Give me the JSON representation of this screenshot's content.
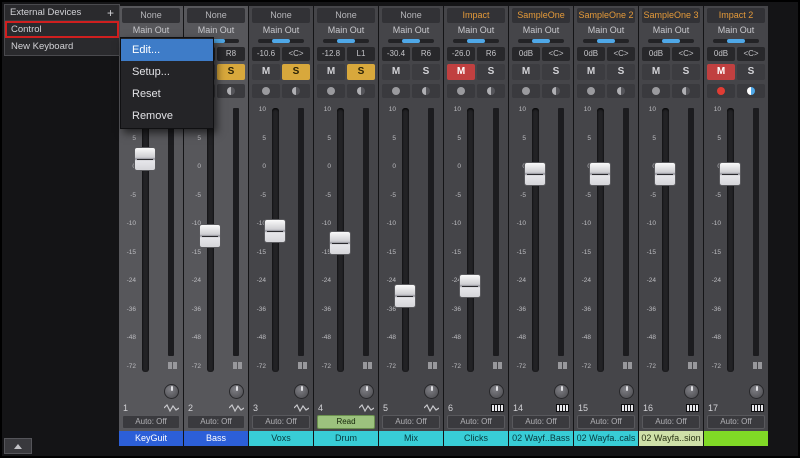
{
  "external_devices": {
    "title": "External Devices",
    "add_label": "+",
    "items": [
      {
        "label": "Control",
        "selected": true
      },
      {
        "label": "New Keyboard",
        "selected": false
      }
    ]
  },
  "context_menu": {
    "items": [
      {
        "label": "Edit...",
        "highlighted": true
      },
      {
        "label": "Setup...",
        "highlighted": false
      },
      {
        "label": "Reset",
        "highlighted": false
      },
      {
        "label": "Remove",
        "highlighted": false
      }
    ]
  },
  "colors": {
    "pan_accent": "#4fa8e8",
    "mute_active": "#c04040",
    "solo_active": "#d8a83c",
    "record_active": "#e03c34",
    "monitor_active": "#4fa8e8",
    "menu_highlight": "#3e7cc8",
    "selection_outline": "#cf1f1f"
  },
  "mixer": {
    "output_label": "Main Out",
    "mute_label": "M",
    "solo_label": "S",
    "scale_labels": [
      "10",
      "5",
      "0",
      "-5",
      "-10",
      "-15",
      "-24",
      "-36",
      "-48",
      "-72"
    ],
    "strips": [
      {
        "number": "1",
        "insert": "None",
        "instrument": false,
        "volume": "",
        "pan": "",
        "mute": false,
        "solo": false,
        "record": false,
        "monitor": false,
        "fader_pos": 0.16,
        "automation": "Auto: Off",
        "automation_read": false,
        "name": "KeyGuit",
        "name_color": "#2c5fd8",
        "name_text_color": "#ffffff",
        "icon": "wave",
        "selected": true
      },
      {
        "number": "2",
        "insert": "None",
        "instrument": false,
        "volume": "",
        "pan": "R8",
        "mute": false,
        "solo": true,
        "record": false,
        "monitor": false,
        "fader_pos": 0.48,
        "automation": "Auto: Off",
        "automation_read": false,
        "name": "Bass",
        "name_color": "#2c5fd8",
        "name_text_color": "#ffffff",
        "icon": "wave",
        "selected": true
      },
      {
        "number": "3",
        "insert": "None",
        "instrument": false,
        "volume": "-10.6",
        "pan": "<C>",
        "mute": false,
        "solo": true,
        "record": false,
        "monitor": false,
        "fader_pos": 0.458,
        "automation": "Auto: Off",
        "automation_read": false,
        "name": "Voxs",
        "name_color": "#38cdd6",
        "name_text_color": "#063a3e",
        "icon": "wave",
        "selected": false
      },
      {
        "number": "4",
        "insert": "None",
        "instrument": false,
        "volume": "-12.8",
        "pan": "L1",
        "mute": false,
        "solo": true,
        "record": false,
        "monitor": false,
        "fader_pos": 0.507,
        "automation": "Read",
        "automation_read": true,
        "name": "Drum",
        "name_color": "#38cdd6",
        "name_text_color": "#063a3e",
        "icon": "wave",
        "selected": false
      },
      {
        "number": "5",
        "insert": "None",
        "instrument": false,
        "volume": "-30.4",
        "pan": "R6",
        "mute": false,
        "solo": false,
        "record": false,
        "monitor": false,
        "fader_pos": 0.726,
        "automation": "Auto: Off",
        "automation_read": false,
        "name": "Mix",
        "name_color": "#38cdd6",
        "name_text_color": "#063a3e",
        "icon": "wave",
        "selected": false
      },
      {
        "number": "6",
        "insert": "Impact",
        "instrument": true,
        "volume": "-26.0",
        "pan": "R6",
        "mute": true,
        "solo": false,
        "record": false,
        "monitor": false,
        "fader_pos": 0.685,
        "automation": "Auto: Off",
        "automation_read": false,
        "name": "Clicks",
        "name_color": "#38cdd6",
        "name_text_color": "#063a3e",
        "icon": "keys",
        "selected": false
      },
      {
        "number": "14",
        "insert": "SampleOne",
        "instrument": true,
        "volume": "0dB",
        "pan": "<C>",
        "mute": false,
        "solo": false,
        "record": false,
        "monitor": false,
        "fader_pos": 0.222,
        "automation": "Auto: Off",
        "automation_read": false,
        "name": "02 Wayf..Bass",
        "name_color": "#38cdd6",
        "name_text_color": "#063a3e",
        "icon": "keys",
        "selected": false
      },
      {
        "number": "15",
        "insert": "SampleOne 2",
        "instrument": true,
        "volume": "0dB",
        "pan": "<C>",
        "mute": false,
        "solo": false,
        "record": false,
        "monitor": false,
        "fader_pos": 0.222,
        "automation": "Auto: Off",
        "automation_read": false,
        "name": "02 Wayfa..cals",
        "name_color": "#38cdd6",
        "name_text_color": "#063a3e",
        "icon": "keys",
        "selected": false
      },
      {
        "number": "16",
        "insert": "SampleOne 3",
        "instrument": true,
        "volume": "0dB",
        "pan": "<C>",
        "mute": false,
        "solo": false,
        "record": false,
        "monitor": false,
        "fader_pos": 0.222,
        "automation": "Auto: Off",
        "automation_read": false,
        "name": "02 Wayfa..sion",
        "name_color": "#cfe0a8",
        "name_text_color": "#2a3314",
        "icon": "keys",
        "selected": false
      },
      {
        "number": "17",
        "insert": "Impact 2",
        "instrument": true,
        "volume": "0dB",
        "pan": "<C>",
        "mute": true,
        "solo": false,
        "record": true,
        "monitor": true,
        "fader_pos": 0.222,
        "automation": "Auto: Off",
        "automation_read": false,
        "name": "",
        "name_color": "#80d926",
        "name_text_color": "#1c2a08",
        "icon": "keys",
        "selected": false
      }
    ]
  }
}
